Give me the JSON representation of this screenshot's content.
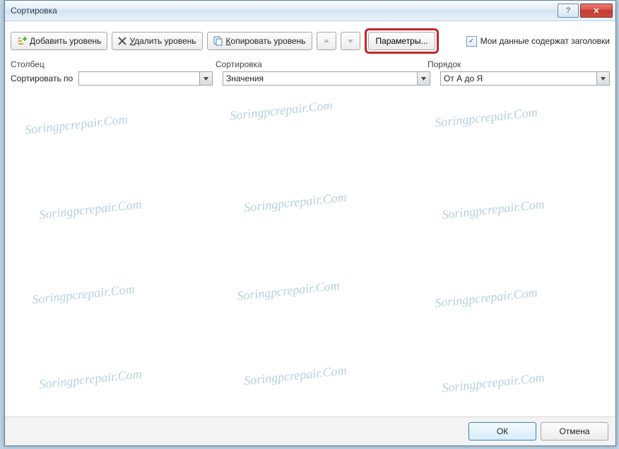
{
  "window": {
    "title": "Сортировка"
  },
  "toolbar": {
    "add_level": "Добавить уровень",
    "delete_level": "Удалить уровень",
    "copy_level": "Копировать уровень",
    "options": "Параметры...",
    "headers_checkbox_label": "Мои данные содержат заголовки",
    "headers_checked": true
  },
  "columns": {
    "col1": "Столбец",
    "col2": "Сортировка",
    "col3": "Порядок"
  },
  "row": {
    "label": "Сортировать по",
    "column_value": "",
    "sort_on_value": "Значения",
    "order_value": "От А до Я"
  },
  "footer": {
    "ok": "ОК",
    "cancel": "Отмена"
  },
  "watermark_text": "Soringpcrepair.Com"
}
